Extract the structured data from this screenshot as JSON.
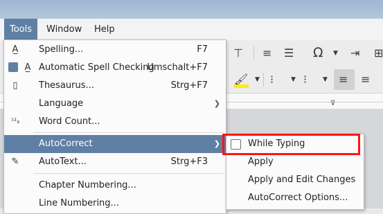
{
  "menubar": {
    "items": [
      {
        "label": "Tools",
        "active": true
      },
      {
        "label": "Window",
        "active": false
      },
      {
        "label": "Help",
        "active": false
      }
    ]
  },
  "tools_menu": {
    "items": [
      {
        "label": "Spelling...",
        "shortcut": "F7",
        "icon": "spelling-icon"
      },
      {
        "label": "Automatic Spell Checking",
        "shortcut": "Umschalt+F7",
        "icon": "check-indicator",
        "checked": true
      },
      {
        "label": "Thesaurus...",
        "shortcut": "Strg+F7",
        "icon": "thesaurus-icon"
      },
      {
        "label": "Language",
        "shortcut": "",
        "icon": "",
        "submenu": true
      },
      {
        "label": "Word Count...",
        "shortcut": "",
        "icon": "word-count-icon"
      },
      {
        "label": "AutoCorrect",
        "shortcut": "",
        "icon": "",
        "submenu": true,
        "highlighted": true
      },
      {
        "label": "AutoText...",
        "shortcut": "Strg+F3",
        "icon": "autotext-icon"
      },
      {
        "label": "Chapter Numbering...",
        "shortcut": "",
        "icon": ""
      },
      {
        "label": "Line Numbering...",
        "shortcut": "",
        "icon": ""
      }
    ]
  },
  "autocorrect_submenu": {
    "items": [
      {
        "label": "While Typing",
        "checked": false
      },
      {
        "label": "Apply"
      },
      {
        "label": "Apply and Edit Changes"
      },
      {
        "label": "AutoCorrect Options..."
      }
    ]
  },
  "colors": {
    "highlight": "#5f80a4",
    "menu_bg": "#fbfbfb",
    "annotation_box": "#ff1414"
  }
}
